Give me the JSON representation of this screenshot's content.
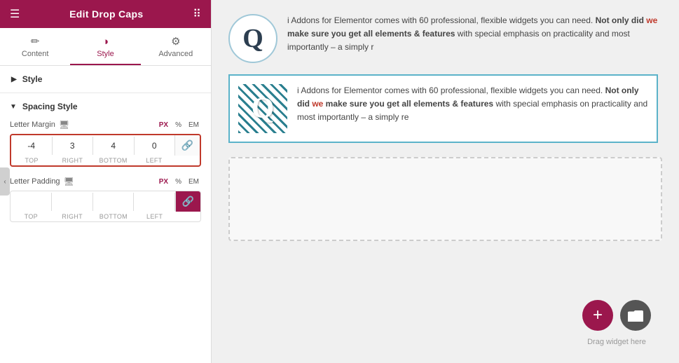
{
  "header": {
    "title": "Edit Drop Caps",
    "hamburger": "☰",
    "grid": "⋮⋮"
  },
  "tabs": [
    {
      "id": "content",
      "label": "Content",
      "icon": "✏️",
      "active": false
    },
    {
      "id": "style",
      "label": "Style",
      "icon": "◑",
      "active": true
    },
    {
      "id": "advanced",
      "label": "Advanced",
      "icon": "⚙",
      "active": false
    }
  ],
  "sections": {
    "style": {
      "label": "Style",
      "arrow": "▶"
    },
    "spacing_style": {
      "label": "Spacing Style",
      "arrow": "▼"
    }
  },
  "letter_margin": {
    "label": "Letter Margin",
    "units": [
      "PX",
      "%",
      "EM"
    ],
    "active_unit": "PX",
    "top": "-4",
    "right": "3",
    "bottom": "4",
    "left": "0",
    "labels": [
      "TOP",
      "RIGHT",
      "BOTTOM",
      "LEFT"
    ],
    "link_icon": "🔗"
  },
  "letter_padding": {
    "label": "Letter Padding",
    "units": [
      "PX",
      "%",
      "EM"
    ],
    "active_unit": "PX",
    "top": "",
    "right": "",
    "bottom": "",
    "left": "",
    "labels": [
      "TOP",
      "RIGHT",
      "BOTTOM",
      "LEFT"
    ],
    "link_icon": "🔗"
  },
  "preview": {
    "widget1": {
      "letter": "Q",
      "text": "i Addons for Elementor comes with 60 professional, flexible widgets you can need. Not only did we make sure you get all elements & features with special emphasis on practicality and most importantly – a simply re"
    },
    "widget2": {
      "letter": "Q",
      "text": "i Addons for Elementor comes with 60 professional, flexible widgets you can need. Not only did we make sure you get all elements & features with special emphasis on practicality and most importantly – a simply re"
    },
    "drag_label": "Drag widget here",
    "fab_add": "+",
    "fab_folder": "▭"
  },
  "collapse_arrow": "‹"
}
